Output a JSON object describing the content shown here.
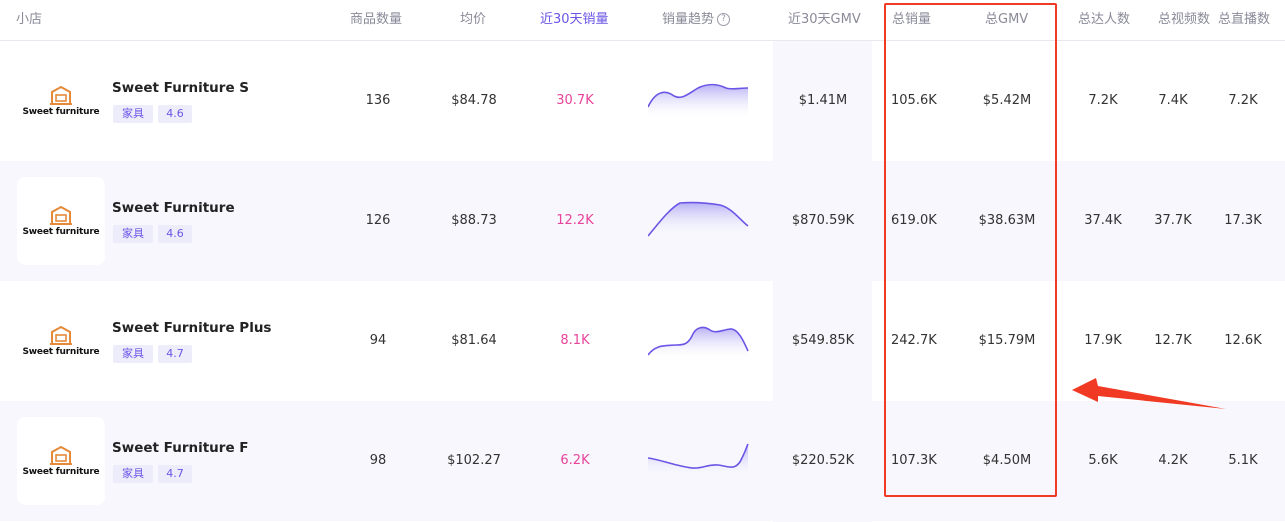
{
  "header": {
    "shop": "小店",
    "product_count": "商品数量",
    "avg_price": "均价",
    "sales_30d": "近30天销量",
    "sales_trend": "销量趋势",
    "gmv_30d": "近30天GMV",
    "total_sales": "总销量",
    "total_gmv": "总GMV",
    "total_creators": "总达人数",
    "total_videos": "总视频数",
    "total_lives": "总直播数"
  },
  "colors": {
    "accent": "#6a55e6",
    "pink": "#e8449a",
    "highlight_box": "#f03a24",
    "logo_orange": "#e58a3a"
  },
  "rows": [
    {
      "logo_text": "Sweet furniture",
      "name": "Sweet Furniture S",
      "category": "家具",
      "rating": "4.6",
      "product_count": "136",
      "avg_price": "$84.78",
      "sales_30d": "30.7K",
      "gmv_30d": "$1.41M",
      "total_sales": "105.6K",
      "total_gmv": "$5.42M",
      "creators": "7.2K",
      "videos": "7.4K",
      "lives": "7.2K"
    },
    {
      "logo_text": "Sweet furniture",
      "name": "Sweet Furniture",
      "category": "家具",
      "rating": "4.6",
      "product_count": "126",
      "avg_price": "$88.73",
      "sales_30d": "12.2K",
      "gmv_30d": "$870.59K",
      "total_sales": "619.0K",
      "total_gmv": "$38.63M",
      "creators": "37.4K",
      "videos": "37.7K",
      "lives": "17.3K"
    },
    {
      "logo_text": "Sweet furniture",
      "name": "Sweet Furniture Plus",
      "category": "家具",
      "rating": "4.7",
      "product_count": "94",
      "avg_price": "$81.64",
      "sales_30d": "8.1K",
      "gmv_30d": "$549.85K",
      "total_sales": "242.7K",
      "total_gmv": "$15.79M",
      "creators": "17.9K",
      "videos": "12.7K",
      "lives": "12.6K"
    },
    {
      "logo_text": "Sweet furniture",
      "name": "Sweet Furniture F",
      "category": "家具",
      "rating": "4.7",
      "product_count": "98",
      "avg_price": "$102.27",
      "sales_30d": "6.2K",
      "gmv_30d": "$220.52K",
      "total_sales": "107.3K",
      "total_gmv": "$4.50M",
      "creators": "5.6K",
      "videos": "4.2K",
      "lives": "5.1K"
    }
  ]
}
